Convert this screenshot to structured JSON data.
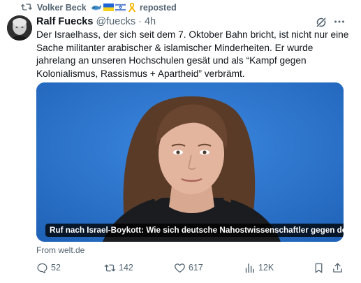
{
  "repost": {
    "user": "Volker Beck",
    "emojis": [
      "whale-emoji",
      "ukraine-flag-emoji",
      "israel-flag-emoji",
      "yellow-ribbon-emoji"
    ],
    "label": "reposted"
  },
  "tweet": {
    "author_name": "Ralf Fuecks",
    "handle": "@fuecks",
    "separator": "·",
    "time": "4h",
    "text": "Der Israelhass, der sich seit dem 7. Oktober Bahn bricht, ist nicht nur eine Sache militanter arabischer & islamischer Minderheiten. Er wurde jahrelang an unseren Hochschulen gesät und als “Kampf gegen Kolonialismus, Rassismus + Apartheid” verbrämt."
  },
  "card": {
    "caption": "Ruf nach Israel-Boykott: Wie sich deutsche Nahostwissenschaftler gegen den …",
    "source": "From welt.de"
  },
  "actions": {
    "replies": "52",
    "reposts": "142",
    "likes": "617",
    "views": "12K"
  },
  "colors": {
    "muted": "#536471",
    "text": "#0f1419",
    "photo_bg": "#2d73c9"
  }
}
